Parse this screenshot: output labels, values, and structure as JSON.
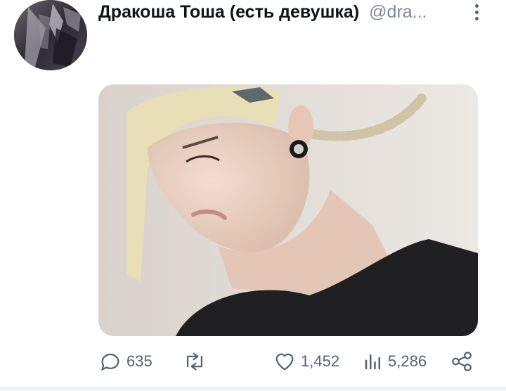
{
  "tweet": {
    "display_name": "Дракоша Тоша (есть девушка)",
    "handle": "@dra...",
    "media": {
      "alt_visible": false
    }
  },
  "actions": {
    "reply_count": "635",
    "retweet_count": "",
    "like_count": "1,452",
    "view_count": "5,286"
  },
  "icons": {
    "reply": "reply-icon",
    "retweet": "retweet-icon",
    "like": "heart-icon",
    "views": "views-icon",
    "share": "share-icon",
    "more": "more-vertical-icon"
  },
  "colors": {
    "text": "#0f1419",
    "secondary": "#536471",
    "handle": "#7d8a96",
    "background": "#ffffff"
  }
}
